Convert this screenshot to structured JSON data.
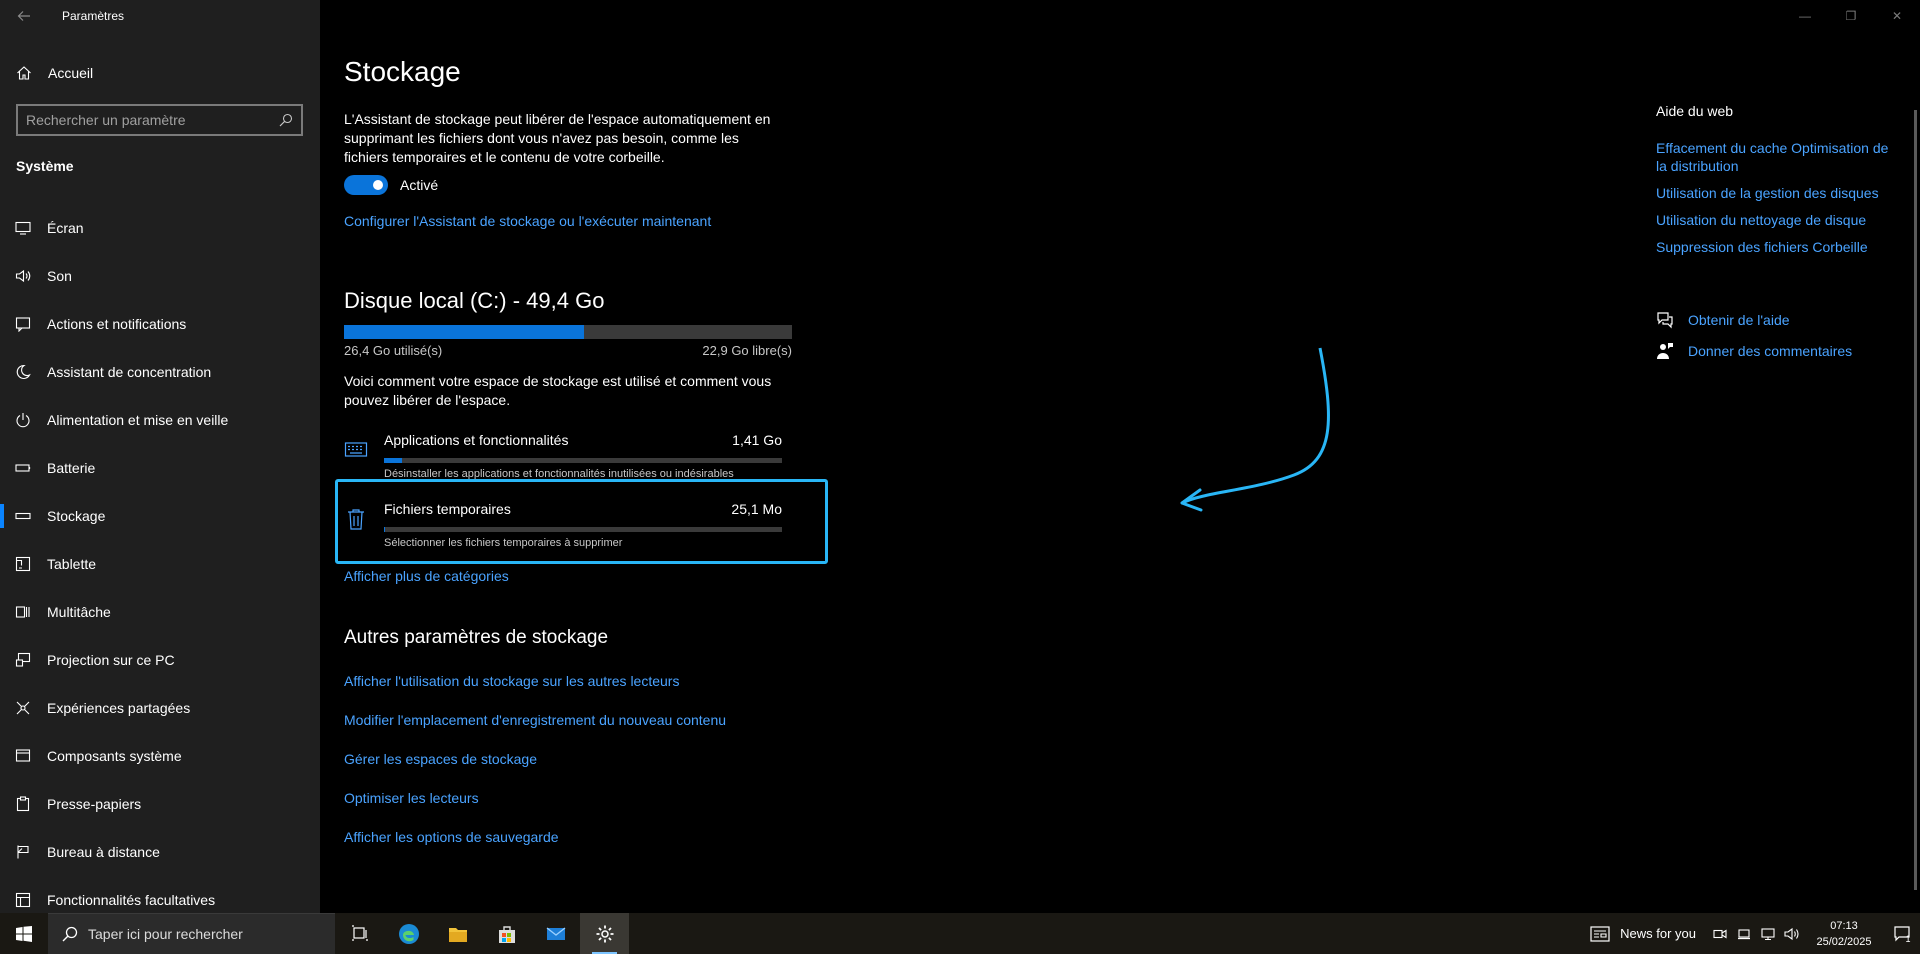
{
  "window": {
    "title": "Paramètres",
    "minimize": "—",
    "restore": "❐",
    "close": "✕"
  },
  "sidebar": {
    "home_label": "Accueil",
    "search_placeholder": "Rechercher un paramètre",
    "section": "Système",
    "items": [
      {
        "label": "Écran",
        "icon": "monitor-icon"
      },
      {
        "label": "Son",
        "icon": "speaker-icon"
      },
      {
        "label": "Actions et notifications",
        "icon": "notification-icon"
      },
      {
        "label": "Assistant de concentration",
        "icon": "moon-icon"
      },
      {
        "label": "Alimentation et mise en veille",
        "icon": "power-icon"
      },
      {
        "label": "Batterie",
        "icon": "battery-icon"
      },
      {
        "label": "Stockage",
        "icon": "storage-icon",
        "active": true
      },
      {
        "label": "Tablette",
        "icon": "tablet-icon"
      },
      {
        "label": "Multitâche",
        "icon": "multitask-icon"
      },
      {
        "label": "Projection sur ce PC",
        "icon": "projection-icon"
      },
      {
        "label": "Expériences partagées",
        "icon": "share-icon"
      },
      {
        "label": "Composants système",
        "icon": "components-icon"
      },
      {
        "label": "Presse-papiers",
        "icon": "clipboard-icon"
      },
      {
        "label": "Bureau à distance",
        "icon": "remote-icon"
      },
      {
        "label": "Fonctionnalités facultatives",
        "icon": "features-icon"
      }
    ]
  },
  "main": {
    "title": "Stockage",
    "sense_description": "L'Assistant de stockage peut libérer de l'espace automatiquement en supprimant les fichiers dont vous n'avez pas besoin, comme les fichiers temporaires et le contenu de votre corbeille.",
    "toggle_label": "Activé",
    "toggle_on": true,
    "configure_link": "Configurer l'Assistant de stockage ou l'exécuter maintenant",
    "disk": {
      "title": "Disque local (C:) - 49,4 Go",
      "used_label": "26,4 Go utilisé(s)",
      "free_label": "22,9 Go libre(s)",
      "used_fraction": 0.535
    },
    "usage_description": "Voici comment votre espace de stockage est utilisé et comment vous pouvez libérer de l'espace.",
    "categories": [
      {
        "name": "Applications et fonctionnalités",
        "size": "1,41 Go",
        "description": "Désinstaller les applications et fonctionnalités inutilisées ou indésirables",
        "fill_fraction": 0.045,
        "icon": "keyboard-icon"
      },
      {
        "name": "Fichiers temporaires",
        "size": "25,1 Mo",
        "description": "Sélectionner les fichiers temporaires à supprimer",
        "fill_fraction": 0.002,
        "icon": "trash-icon"
      }
    ],
    "more_categories_link": "Afficher plus de catégories",
    "other_title": "Autres paramètres de stockage",
    "other_links": [
      "Afficher l'utilisation du stockage sur les autres lecteurs",
      "Modifier l'emplacement d'enregistrement du nouveau contenu",
      "Gérer les espaces de stockage",
      "Optimiser les lecteurs",
      "Afficher les options de sauvegarde"
    ]
  },
  "right_panel": {
    "web_help_title": "Aide du web",
    "web_links": [
      "Effacement du cache Optimisation de la distribution",
      "Utilisation de la gestion des disques",
      "Utilisation du nettoyage de disque",
      "Suppression des fichiers Corbeille"
    ],
    "get_help": "Obtenir de l'aide",
    "give_feedback": "Donner des commentaires"
  },
  "taskbar": {
    "search_placeholder": "Taper ici pour rechercher",
    "apps": [
      "task-view-icon",
      "edge-icon",
      "file-explorer-icon",
      "store-icon",
      "mail-icon",
      "settings-icon"
    ],
    "news_label": "News for you",
    "time": "07:13",
    "date": "25/02/2025",
    "notification_count": "1"
  },
  "colors": {
    "accent": "#0a74da",
    "link": "#4aa3ff",
    "highlight": "#29b6f6",
    "sidebar_bg": "#1f1f1f",
    "main_bg": "#000000"
  }
}
